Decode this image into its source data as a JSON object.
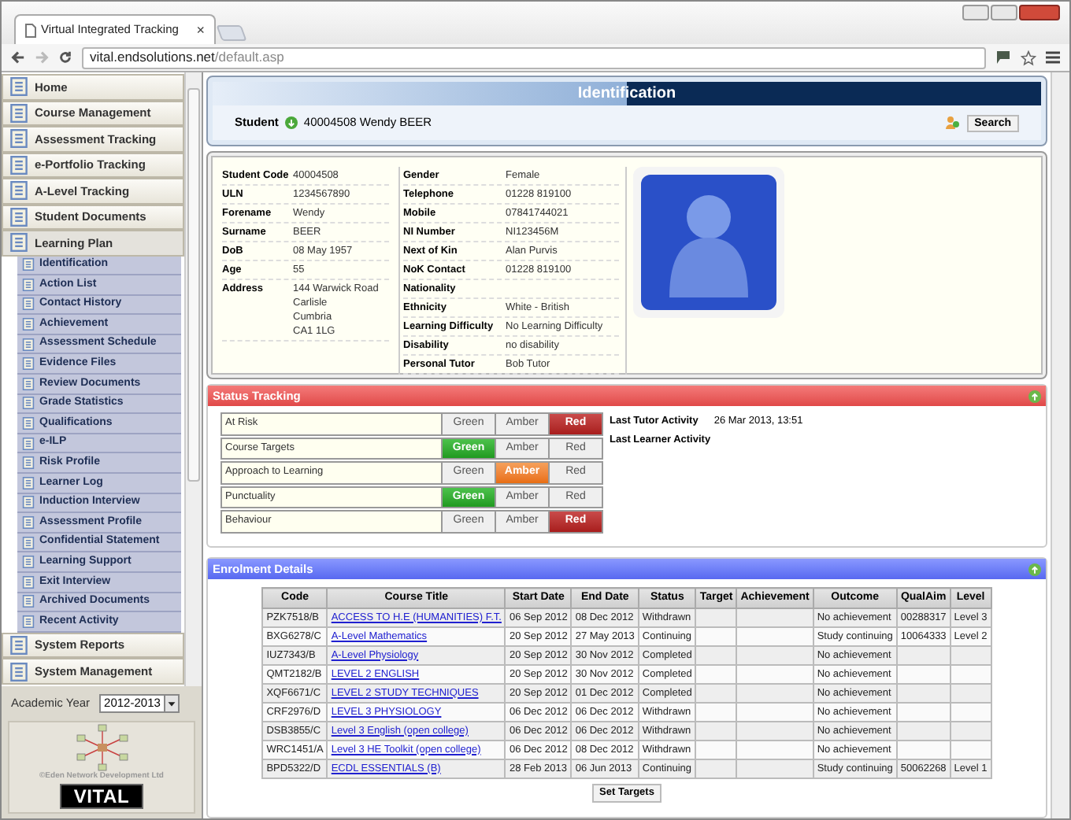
{
  "browser": {
    "tab_title": "Virtual Integrated Tracking",
    "tab_close": "×",
    "url_host": "vital.endsolutions.net",
    "url_path": "/default.asp"
  },
  "sidebar": {
    "items": [
      {
        "label": "Home",
        "kind": "section"
      },
      {
        "label": "Course Management",
        "kind": "section"
      },
      {
        "label": "Assessment Tracking",
        "kind": "section"
      },
      {
        "label": "e-Portfolio Tracking",
        "kind": "section"
      },
      {
        "label": "A-Level Tracking",
        "kind": "section"
      },
      {
        "label": "Student Documents",
        "kind": "section"
      },
      {
        "label": "Learning Plan",
        "kind": "open"
      },
      {
        "label": "Identification",
        "kind": "sub"
      },
      {
        "label": "Action List",
        "kind": "sub"
      },
      {
        "label": "Contact History",
        "kind": "sub"
      },
      {
        "label": "Achievement",
        "kind": "sub"
      },
      {
        "label": "Assessment Schedule",
        "kind": "sub"
      },
      {
        "label": "Evidence Files",
        "kind": "sub"
      },
      {
        "label": "Review Documents",
        "kind": "sub"
      },
      {
        "label": "Grade Statistics",
        "kind": "sub"
      },
      {
        "label": "Qualifications",
        "kind": "sub"
      },
      {
        "label": "e-ILP",
        "kind": "sub"
      },
      {
        "label": "Risk Profile",
        "kind": "sub"
      },
      {
        "label": "Learner Log",
        "kind": "sub"
      },
      {
        "label": "Induction Interview",
        "kind": "sub"
      },
      {
        "label": "Assessment Profile",
        "kind": "sub"
      },
      {
        "label": "Confidential Statement",
        "kind": "sub"
      },
      {
        "label": "Learning Support",
        "kind": "sub"
      },
      {
        "label": "Exit Interview",
        "kind": "sub"
      },
      {
        "label": "Archived Documents",
        "kind": "sub"
      },
      {
        "label": "Recent Activity",
        "kind": "sub"
      },
      {
        "label": "System Reports",
        "kind": "section"
      },
      {
        "label": "System Management",
        "kind": "section"
      }
    ],
    "academic_year": {
      "label": "Academic Year",
      "value": "2012-2013"
    },
    "logo": {
      "copyright": "©Eden Network Development Ltd",
      "wordmark": "VITAL"
    }
  },
  "header": {
    "title": "Identification",
    "student_label": "Student",
    "student_value": "40004508 Wendy BEER",
    "search_button": "Search"
  },
  "details": {
    "left": [
      {
        "label": "Student Code",
        "value": [
          "40004508"
        ]
      },
      {
        "label": "ULN",
        "value": [
          "1234567890"
        ]
      },
      {
        "label": "Forename",
        "value": [
          "Wendy"
        ]
      },
      {
        "label": "Surname",
        "value": [
          "BEER"
        ]
      },
      {
        "label": "DoB",
        "value": [
          "08 May 1957"
        ]
      },
      {
        "label": "Age",
        "value": [
          "55"
        ]
      },
      {
        "label": "Address",
        "value": [
          "144 Warwick Road",
          "Carlisle",
          "Cumbria",
          "CA1 1LG"
        ]
      }
    ],
    "middle": [
      {
        "label": "Gender",
        "value": "Female"
      },
      {
        "label": "Telephone",
        "value": "01228 819100"
      },
      {
        "label": "Mobile",
        "value": "07841744021"
      },
      {
        "label": "NI Number",
        "value": "NI123456M"
      },
      {
        "label": "Next of Kin",
        "value": "Alan Purvis"
      },
      {
        "label": "NoK Contact",
        "value": "01228 819100"
      },
      {
        "label": "Nationality"
      },
      {
        "label": "Ethnicity",
        "value": "White - British"
      },
      {
        "label": "Learning Difficulty",
        "value": "No Learning Difficulty"
      },
      {
        "label": "Disability",
        "value": "no disability"
      },
      {
        "label": "Personal Tutor",
        "value": "Bob Tutor"
      }
    ]
  },
  "status_tracking": {
    "title": "Status Tracking",
    "rows": [
      {
        "label": "At Risk",
        "options": [
          {
            "label": "Green",
            "kind": "green",
            "selected": false
          },
          {
            "label": "Amber",
            "kind": "amber",
            "selected": false
          },
          {
            "label": "Red",
            "kind": "red",
            "selected": true
          }
        ]
      },
      {
        "label": "Course Targets",
        "options": [
          {
            "label": "Green",
            "kind": "green",
            "selected": true
          },
          {
            "label": "Amber",
            "kind": "amber",
            "selected": false
          },
          {
            "label": "Red",
            "kind": "red",
            "selected": false
          }
        ]
      },
      {
        "label": "Approach to Learning",
        "options": [
          {
            "label": "Green",
            "kind": "green",
            "selected": false
          },
          {
            "label": "Amber",
            "kind": "amber",
            "selected": true
          },
          {
            "label": "Red",
            "kind": "red",
            "selected": false
          }
        ]
      },
      {
        "label": "Punctuality",
        "options": [
          {
            "label": "Green",
            "kind": "green",
            "selected": true
          },
          {
            "label": "Amber",
            "kind": "amber",
            "selected": false
          },
          {
            "label": "Red",
            "kind": "red",
            "selected": false
          }
        ]
      },
      {
        "label": "Behaviour",
        "options": [
          {
            "label": "Green",
            "kind": "green",
            "selected": false
          },
          {
            "label": "Amber",
            "kind": "amber",
            "selected": false
          },
          {
            "label": "Red",
            "kind": "red",
            "selected": true
          }
        ]
      }
    ],
    "activity": [
      {
        "label": "Last Tutor Activity",
        "value": "26 Mar 2013, 13:51"
      },
      {
        "label": "Last Learner Activity"
      }
    ]
  },
  "enrolment": {
    "title": "Enrolment Details",
    "columns": [
      "Code",
      "Course Title",
      "Start Date",
      "End Date",
      "Status",
      "Target",
      "Achievement",
      "Outcome",
      "QualAim",
      "Level"
    ],
    "rows": [
      [
        "PZK7518/B",
        "ACCESS TO H.E (HUMANITIES) F.T.",
        "06 Sep 2012",
        "08 Dec 2012",
        "Withdrawn",
        "",
        "",
        "No achievement",
        "00288317",
        "Level 3"
      ],
      [
        "BXG6278/C",
        "A-Level Mathematics",
        "20 Sep 2012",
        "27 May 2013",
        "Continuing",
        "",
        "",
        "Study continuing",
        "10064333",
        "Level 2"
      ],
      [
        "IUZ7343/B",
        "A-Level Physiology",
        "20 Sep 2012",
        "30 Nov 2012",
        "Completed",
        "",
        "",
        "No achievement",
        "",
        ""
      ],
      [
        "QMT2182/B",
        "LEVEL 2 ENGLISH",
        "20 Sep 2012",
        "30 Nov 2012",
        "Completed",
        "",
        "",
        "No achievement",
        "",
        ""
      ],
      [
        "XQF6671/C",
        "LEVEL 2 STUDY TECHNIQUES",
        "20 Sep 2012",
        "01 Dec 2012",
        "Completed",
        "",
        "",
        "No achievement",
        "",
        ""
      ],
      [
        "CRF2976/D",
        "LEVEL 3 PHYSIOLOGY",
        "06 Dec 2012",
        "06 Dec 2012",
        "Withdrawn",
        "",
        "",
        "No achievement",
        "",
        ""
      ],
      [
        "DSB3855/C",
        "Level 3 English (open college)",
        "06 Dec 2012",
        "06 Dec 2012",
        "Withdrawn",
        "",
        "",
        "No achievement",
        "",
        ""
      ],
      [
        "WRC1451/A",
        "Level 3 HE Toolkit (open college)",
        "06 Dec 2012",
        "08 Dec 2012",
        "Withdrawn",
        "",
        "",
        "No achievement",
        "",
        ""
      ],
      [
        "BPD5322/D",
        "ECDL ESSENTIALS (B)",
        "28 Feb 2013",
        "06 Jun 2013",
        "Continuing",
        "",
        "",
        "Study continuing",
        "50062268",
        "Level 1"
      ]
    ],
    "button": "Set Targets"
  }
}
